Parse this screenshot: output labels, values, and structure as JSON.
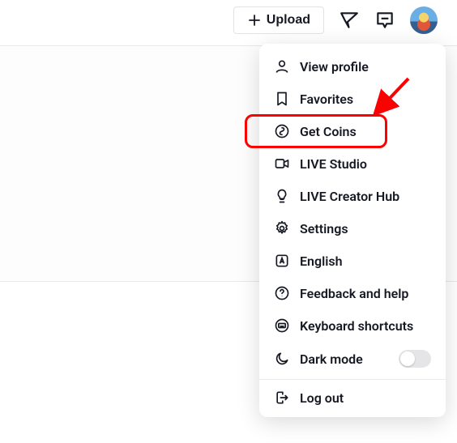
{
  "topbar": {
    "upload_label": "Upload"
  },
  "menu": {
    "view_profile": "View profile",
    "favorites": "Favorites",
    "get_coins": "Get Coins",
    "live_studio": "LIVE Studio",
    "live_creator_hub": "LIVE Creator Hub",
    "settings": "Settings",
    "language": "English",
    "feedback": "Feedback and help",
    "keyboard_shortcuts": "Keyboard shortcuts",
    "dark_mode": "Dark mode",
    "logout": "Log out"
  },
  "annotation": {
    "highlight_target": "get_coins"
  }
}
